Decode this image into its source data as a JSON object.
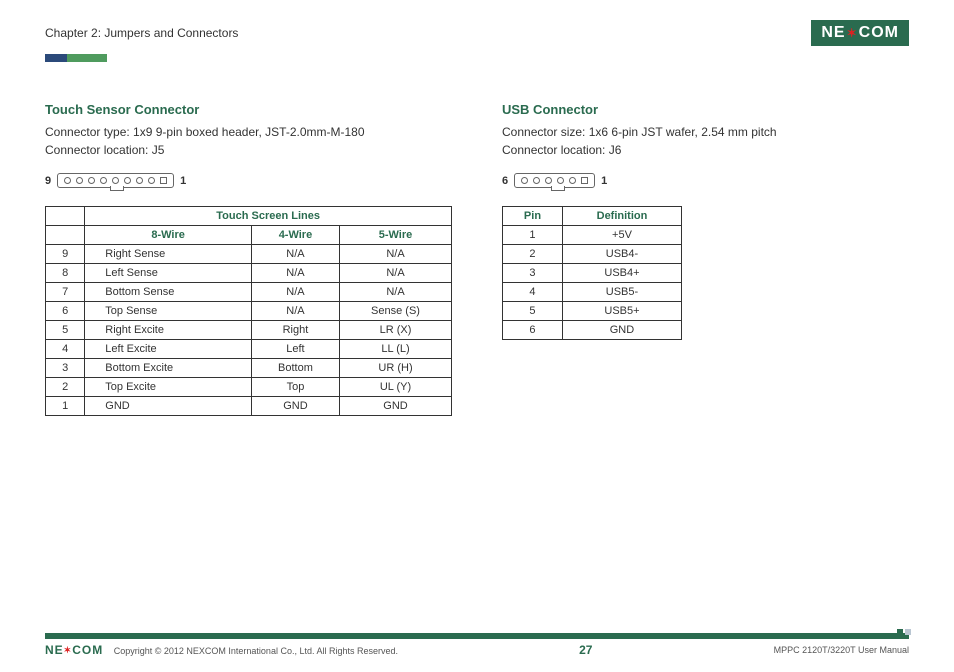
{
  "header": {
    "chapter": "Chapter 2: Jumpers and Connectors",
    "logo_text_left": "NE",
    "logo_text_right": "COM"
  },
  "left": {
    "title": "Touch Sensor Connector",
    "desc1": "Connector type: 1x9 9-pin boxed header, JST-2.0mm-M-180",
    "desc2": "Connector location: J5",
    "pin_left": "9",
    "pin_right": "1",
    "table": {
      "group_header": "Touch Screen Lines",
      "cols": [
        "",
        "8-Wire",
        "4-Wire",
        "5-Wire"
      ],
      "rows": [
        [
          "9",
          "Right Sense",
          "N/A",
          "N/A"
        ],
        [
          "8",
          "Left Sense",
          "N/A",
          "N/A"
        ],
        [
          "7",
          "Bottom Sense",
          "N/A",
          "N/A"
        ],
        [
          "6",
          "Top Sense",
          "N/A",
          "Sense (S)"
        ],
        [
          "5",
          "Right Excite",
          "Right",
          "LR (X)"
        ],
        [
          "4",
          "Left Excite",
          "Left",
          "LL (L)"
        ],
        [
          "3",
          "Bottom Excite",
          "Bottom",
          "UR (H)"
        ],
        [
          "2",
          "Top Excite",
          "Top",
          "UL (Y)"
        ],
        [
          "1",
          "GND",
          "GND",
          "GND"
        ]
      ]
    }
  },
  "right": {
    "title": "USB Connector",
    "desc1": "Connector size:  1x6 6-pin JST wafer, 2.54 mm pitch",
    "desc2": "Connector location: J6",
    "pin_left": "6",
    "pin_right": "1",
    "table": {
      "cols": [
        "Pin",
        "Definition"
      ],
      "rows": [
        [
          "1",
          "+5V"
        ],
        [
          "2",
          "USB4-"
        ],
        [
          "3",
          "USB4+"
        ],
        [
          "4",
          "USB5-"
        ],
        [
          "5",
          "USB5+"
        ],
        [
          "6",
          "GND"
        ]
      ]
    }
  },
  "footer": {
    "copyright": "Copyright © 2012 NEXCOM International Co., Ltd. All Rights Reserved.",
    "page": "27",
    "manual": "MPPC 2120T/3220T User Manual",
    "logo_text_left": "NE",
    "logo_text_right": "COM"
  }
}
